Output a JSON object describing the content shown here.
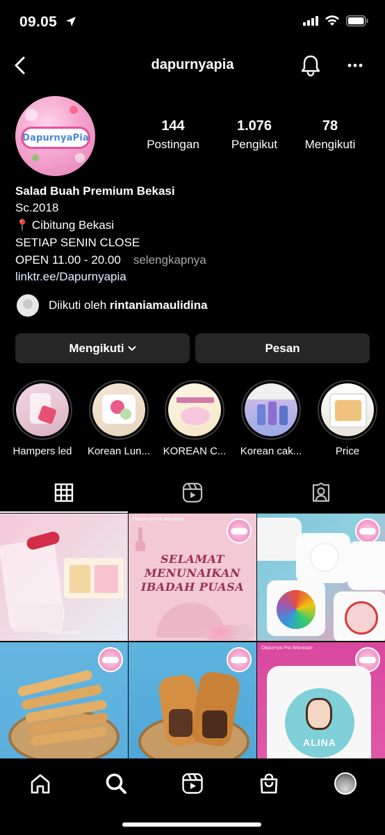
{
  "status_bar": {
    "time": "09.05"
  },
  "header": {
    "username": "dapurnyapia"
  },
  "profile": {
    "logo_text": "DapurnyaPia",
    "stats": [
      {
        "value": "144",
        "label": "Postingan"
      },
      {
        "value": "1.076",
        "label": "Pengikut"
      },
      {
        "value": "78",
        "label": "Mengikuti"
      }
    ],
    "bio": {
      "name": "Salad Buah Premium Bekasi",
      "line1": "Sc.2018",
      "line2_pin": "📍",
      "line2": "Cibitung Bekasi",
      "line3": "SETIAP SENIN CLOSE",
      "line4": "OPEN 11.00 - 20.00",
      "more": "selengkapnya",
      "link": "linktr.ee/Dapurnyapia"
    },
    "followed_by": {
      "prefix": "Diikuti oleh ",
      "user": "rintaniamaulidina"
    },
    "buttons": {
      "following": "Mengikuti",
      "message": "Pesan"
    }
  },
  "highlights": [
    {
      "label": "Hampers led"
    },
    {
      "label": "Korean Lun..."
    },
    {
      "label": "KOREAN C..."
    },
    {
      "label": "Korean cak..."
    },
    {
      "label": "Price"
    }
  ],
  "grid": {
    "post2_text": "SELAMAT MENUNAIKAN IBADAH PUASA",
    "post9_text": "ALINA",
    "watermark": "@dapurnyapia",
    "store_tag": "Dapurnya Pia Wanasari"
  },
  "colors": {
    "background": "#000000",
    "button": "#262626",
    "brand_pink": "#e94ea0"
  }
}
